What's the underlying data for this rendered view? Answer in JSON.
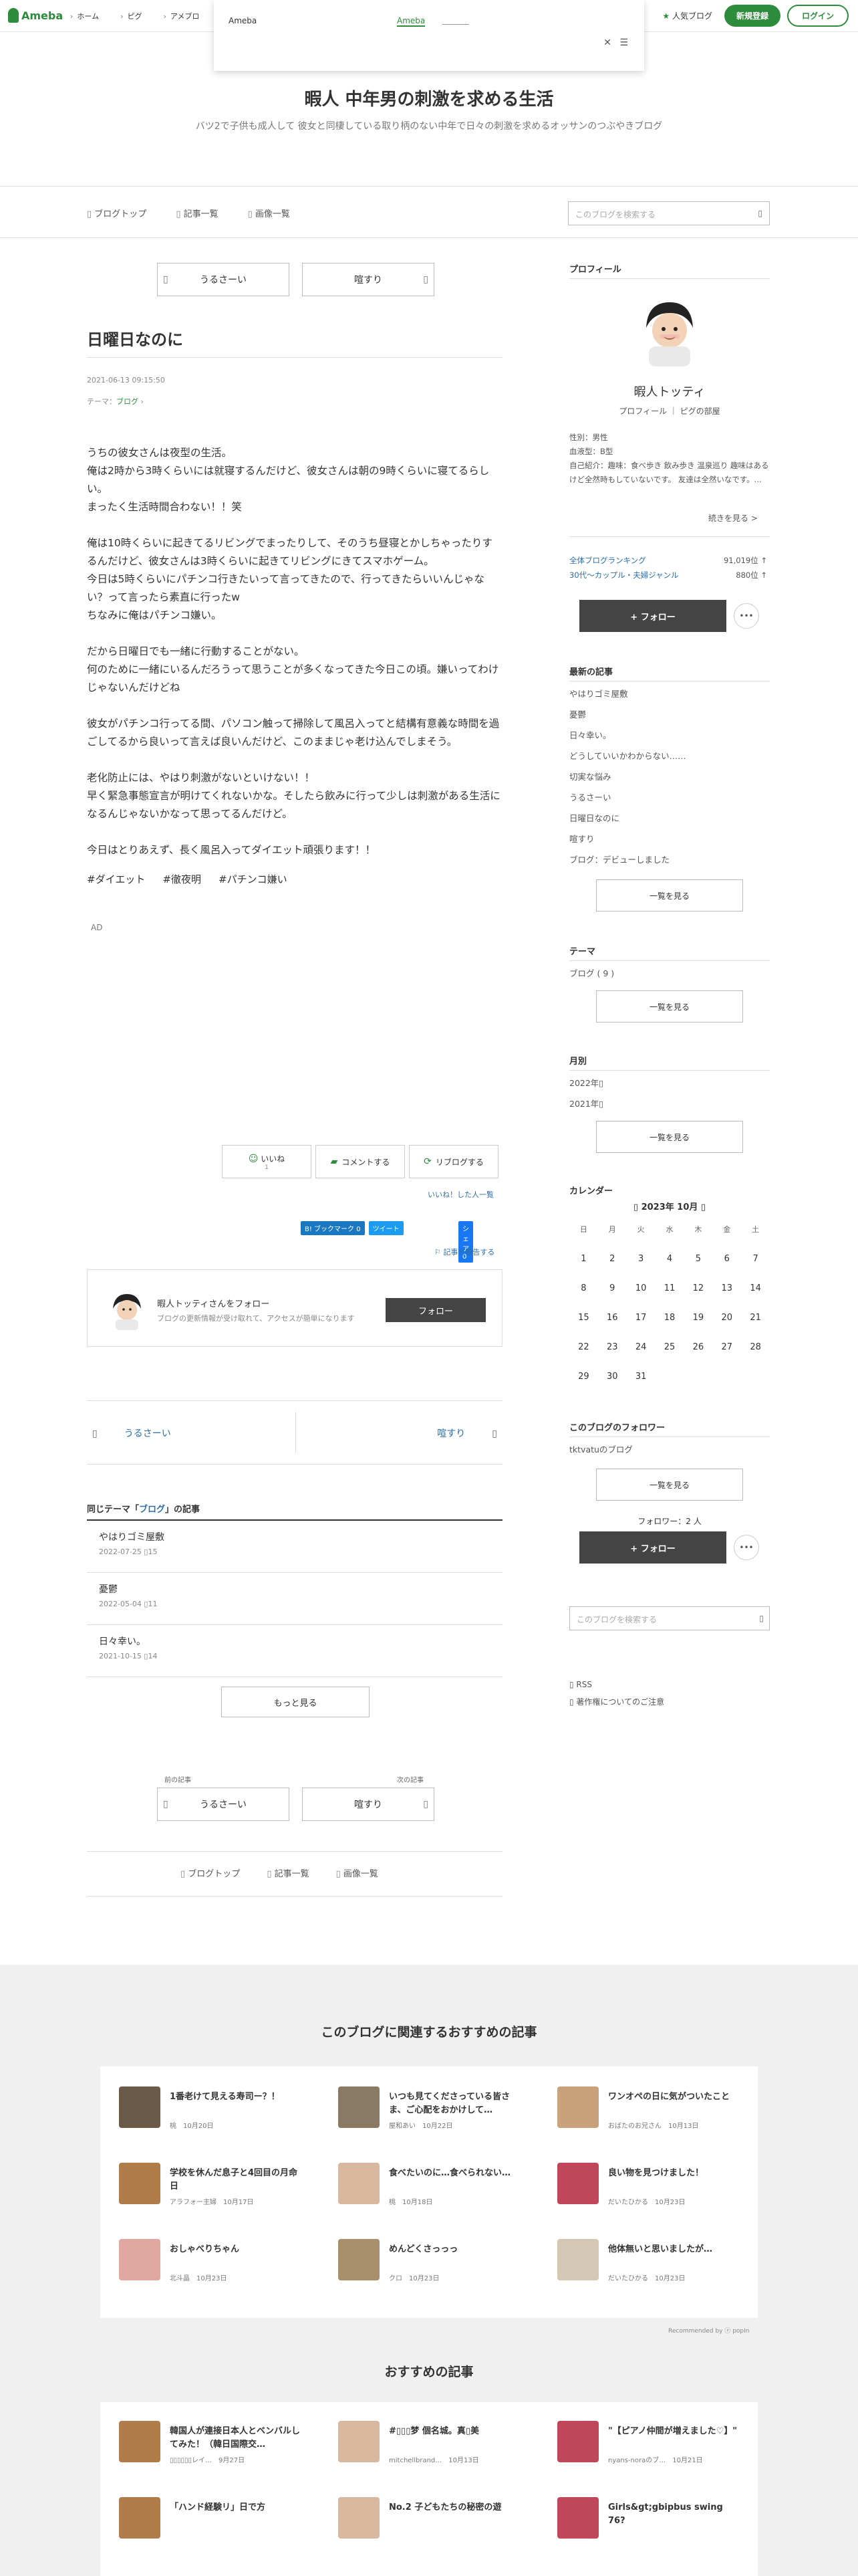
{
  "global": {
    "logo": "Ameba",
    "nav": [
      "ホーム",
      "ピグ",
      "アメブロ"
    ],
    "popular_blog": "人気ブログ",
    "register": "新規登録",
    "login": "ログイン",
    "dropdown_left": "Ameba",
    "dropdown_mid": "Ameba",
    "dropdown_icons": "✕ ☰"
  },
  "blog": {
    "title": "暇人 中年男の刺激を求める生活",
    "description": "バツ2で子供も成人して 彼女と同棲している取り柄のない中年で日々の刺激を求めるオッサンのつぶやきブログ",
    "nav": [
      "ブログトップ",
      "記事一覧",
      "画像一覧"
    ],
    "search_placeholder": "このブログを検索する"
  },
  "entry": {
    "prev_label": "うるさーい",
    "next_label": "喧すり",
    "title": "日曜日なのに",
    "date": "2021-06-13 09:15:50",
    "theme_prefix": "テーマ：",
    "theme": "ブログ",
    "paragraphs": [
      "うちの彼女さんは夜型の生活。\n俺は2時から3時くらいには就寝するんだけど、彼女さんは朝の9時くらいに寝てるらしい。\nまったく生活時間合わない！！笑",
      "俺は10時くらいに起きてるリビングでまったりして、そのうち昼寝とかしちゃったりするんだけど、彼女さんは3時くらいに起きてリビングにきてスマホゲーム。\n今日は5時くらいにパチンコ行きたいって言ってきたので、行ってきたらいいんじゃない？って言ったら素直に行ったw\nちなみに俺はパチンコ嫌い。",
      "だから日曜日でも一緒に行動することがない。\n何のために一緒にいるんだろうって思うことが多くなってきた今日この頃。嫌いってわけじゃないんだけどね",
      "彼女がパチンコ行ってる間、パソコン触って掃除して風呂入ってと結構有意義な時間を過ごしてるから良いって言えば良いんだけど、このままじゃ老け込んでしまそう。",
      "老化防止には、やはり刺激がないといけない！！\n早く緊急事態宣言が明けてくれないかな。そしたら飲みに行って少しは刺激がある生活になるんじゃないかなって思ってるんだけど。",
      "今日はとりあえず、長く風呂入ってダイエット頑張ります！！"
    ],
    "hashtags": [
      "#ダイエット",
      "#徹夜明",
      "#パチンコ嫌い"
    ],
    "ad": "AD",
    "like": "いいね",
    "like_count": "1",
    "comment": "コメントする",
    "reblog": "リブログする",
    "like_users": "いいね！した人一覧",
    "share_hatena": "B! ブックマーク 0",
    "share_twitter": "ツイート",
    "share_facebook": "シェア 0",
    "report": "記事を報告する",
    "follow_name": "暇人トッティさんをフォロー",
    "follow_sub": "ブログの更新情報が受け取れて、アクセスが簡単になります",
    "follow_btn": "フォロー",
    "post_prev": "うるさーい",
    "post_next": "喧すり",
    "same_theme_prefix": "同じテーマ「",
    "same_theme_name": "ブログ",
    "same_theme_suffix": "」の記事",
    "same_theme_items": [
      {
        "title": "やはりゴミ屋敷",
        "meta": "2022-07-25 ▯15"
      },
      {
        "title": "憂鬱",
        "meta": "2022-05-04 ▯11"
      },
      {
        "title": "日々幸い。",
        "meta": "2021-10-15 ▯14"
      }
    ],
    "more": "もっと見る",
    "prev_caption": "前の記事",
    "next_caption": "次の記事",
    "bottom_prev": "うるさーい",
    "bottom_next": "喧すり"
  },
  "sidebar": {
    "profile_h": "プロフィール",
    "name": "暇人トッティ",
    "links": "プロフィール ｜ ピグの部屋",
    "info": "性別：男性\n血液型：B型\n自己紹介：趣味：食べ歩き 飲み歩き 温泉巡り 趣味はあるけど全然時もしていないです。 友達は全然いなです。...",
    "read_more": "続きを見る >",
    "rank1_label": "全体ブログランキング",
    "rank1_value": "91,019位 ↑",
    "rank2_label": "30代〜カップル・夫婦ジャンル",
    "rank2_value": "880位 ↑",
    "follow": "+ フォロー",
    "dots": "•••",
    "recent_h": "最新の記事",
    "recent": [
      "やはりゴミ屋敷",
      "憂鬱",
      "日々幸い。",
      "どうしていいかわからない……",
      "切実な悩み",
      "うるさーい",
      "日曜日なのに",
      "喧すり",
      "ブログ：デビューしました"
    ],
    "list_all": "一覧を見る",
    "theme_h": "テーマ",
    "themes": [
      "ブログ ( 9 )"
    ],
    "month_h": "月別",
    "months": [
      "2022年▯",
      "2021年▯"
    ],
    "calendar_h": "カレンダー",
    "calendar_title": "2023年 10月",
    "weekdays": [
      "日",
      "月",
      "火",
      "水",
      "木",
      "金",
      "土"
    ],
    "weeks": [
      [
        "1",
        "2",
        "3",
        "4",
        "5",
        "6",
        "7"
      ],
      [
        "8",
        "9",
        "10",
        "11",
        "12",
        "13",
        "14"
      ],
      [
        "15",
        "16",
        "17",
        "18",
        "19",
        "20",
        "21"
      ],
      [
        "22",
        "23",
        "24",
        "25",
        "26",
        "27",
        "28"
      ],
      [
        "29",
        "30",
        "31",
        "",
        "",
        "",
        ""
      ]
    ],
    "followers_h": "このブログのフォロワー",
    "follower_blogs": "tktvatuのブログ",
    "follower_count": "フォロワー：2 人",
    "search_placeholder": "このブログを検索する",
    "rss": "RSS",
    "copyright": "著作権についてのご注意"
  },
  "reco": {
    "heading1": "このブログに関連するおすすめの記事",
    "items1": [
      {
        "title": "1番老けて見える寿司ー？！",
        "meta": "桃　10月20日"
      },
      {
        "title": "いつも見てくださっている皆さま、ご心配をおかけして…",
        "meta": "屋和あい　10月22日"
      },
      {
        "title": "ワンオペの日に気がついたこと",
        "meta": "おばたのお兄さん　10月13日"
      },
      {
        "title": "学校を休んだ息子と4回目の月命日",
        "meta": "アラフォー主婦　10月17日"
      },
      {
        "title": "食べたいのに…食べられない…",
        "meta": "桃　10月18日"
      },
      {
        "title": "良い物を見つけました！",
        "meta": "だいたひかる　10月23日"
      },
      {
        "title": "おしゃべりちゃん",
        "meta": "北斗晶　10月23日"
      },
      {
        "title": "めんどくさっっっ",
        "meta": "クロ　10月23日"
      },
      {
        "title": "他体無いと思いましたが…",
        "meta": "だいたひかる　10月23日"
      }
    ],
    "recommended_by": "Recommended by ⓩ popIn",
    "heading2": "おすすめの記事",
    "items2": [
      {
        "title": "韓国人が連接日本人とベンバルしてみた！（韓日国際交…",
        "meta": "▯▯▯▯▯▯レイ…　9月27日"
      },
      {
        "title": "#▯▯▯梦 個名城。真▯美",
        "meta": "mitchellbrand…　10月13日"
      },
      {
        "title": "\"【ピアノ仲間が増えました♡】\"",
        "meta": "nyans-noraのブ…　10月21日"
      }
    ],
    "items3": [
      {
        "title": "「ハンド経験リ」日で方",
        "meta": ""
      },
      {
        "title": "No.2 子どもたちの秘密の遊",
        "meta": ""
      },
      {
        "title": "Girls&gt;gbipbus swing 76?",
        "meta": ""
      }
    ]
  },
  "colors": {
    "accent": "#2d8c3c",
    "link": "#2d6ea8",
    "grey_bg": "#f0f0f0"
  }
}
